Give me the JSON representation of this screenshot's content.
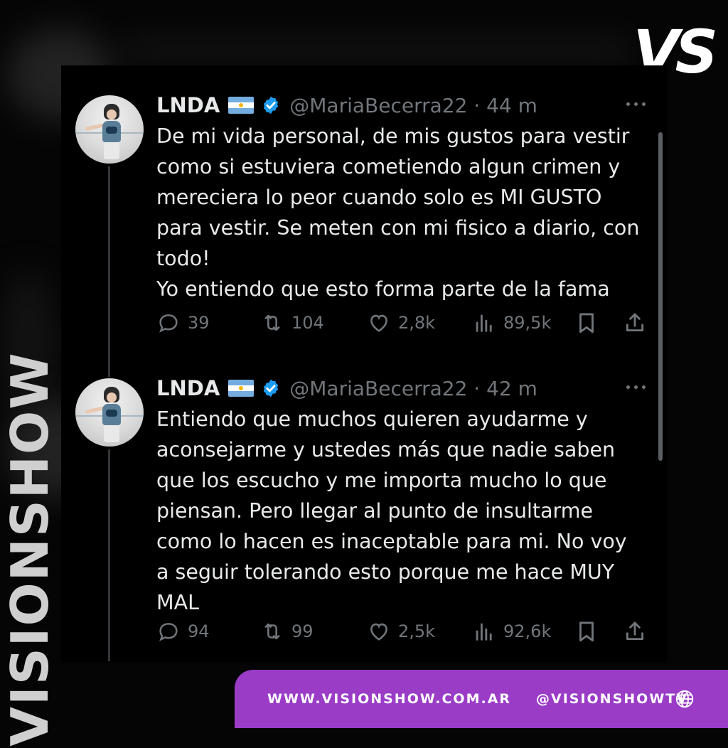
{
  "brand": {
    "logo": "VS",
    "side_text": "VISIONSHOW",
    "website": "WWW.VISIONSHOW.COM.AR",
    "social_handle": "@VISIONSHOWTV",
    "footer_color": "#9b3cc7"
  },
  "tweets": [
    {
      "name": "LNDA",
      "handle": "@MariaBecerra22 · 44 m",
      "text": "De mi vida personal, de mis gustos para vestir\ncomo si estuviera cometiendo algun crimen y\nmereciera lo peor cuando solo es MI GUSTO\npara vestir. Se meten con mi fisico a diario, con\ntodo!\nYo entiendo que esto forma parte de la fama",
      "replies": "39",
      "retweets": "104",
      "likes": "2,8k",
      "views": "89,5k"
    },
    {
      "name": "LNDA",
      "handle": "@MariaBecerra22 · 42 m",
      "text": "Entiendo que muchos quieren ayudarme y\naconsejarme y ustedes más que nadie saben\nque los escucho y me importa mucho lo que\npiensan. Pero llegar al punto de insultarme\ncomo lo hacen es inaceptable para mi. No voy\na seguir tolerando esto porque me hace MUY\nMAL",
      "replies": "94",
      "retweets": "99",
      "likes": "2,5k",
      "views": "92,6k"
    }
  ],
  "icons": {
    "flag": "argentina-flag-icon",
    "verified": "verified-badge-icon",
    "more": "more-icon",
    "reply": "reply-icon",
    "retweet": "retweet-icon",
    "like": "heart-icon",
    "views": "views-icon",
    "bookmark": "bookmark-icon",
    "share": "share-icon",
    "globe": "globe-icon"
  },
  "colors": {
    "background": "#000000",
    "text": "#e7e9ea",
    "muted": "#71767b",
    "verified": "#1d9bf0"
  }
}
